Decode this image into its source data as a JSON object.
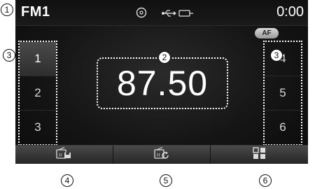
{
  "status": {
    "band": "FM1",
    "time": "0:00",
    "icons": [
      "disc-icon",
      "usb-icon",
      "battery-plug-icon"
    ]
  },
  "af_badge": "AF",
  "presets_left": [
    {
      "label": "1",
      "active": true
    },
    {
      "label": "2",
      "active": false
    },
    {
      "label": "3",
      "active": false
    }
  ],
  "presets_right": [
    {
      "label": "4",
      "active": false
    },
    {
      "label": "5",
      "active": false
    },
    {
      "label": "6",
      "active": false
    }
  ],
  "frequency": "87.50",
  "bottom_buttons": [
    {
      "icon": "radio-save-icon"
    },
    {
      "icon": "radio-scan-icon"
    },
    {
      "icon": "menu-grid-icon"
    }
  ],
  "callouts": {
    "c1": "1",
    "c2": "2",
    "c3_left": "3",
    "c3_right": "3",
    "c4": "4",
    "c5": "5",
    "c6": "6"
  }
}
